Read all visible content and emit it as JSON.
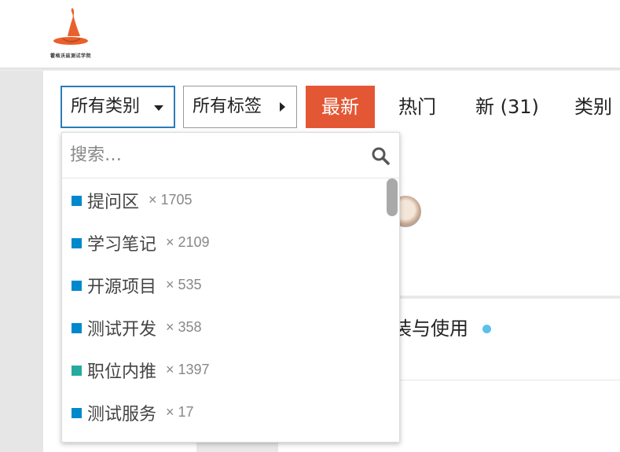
{
  "header": {
    "logo_text": "霍格沃兹测试学院",
    "logo_icon": "witch-hat-icon",
    "accent": "#e8612c"
  },
  "nav": {
    "categories_dropdown": "所有类别",
    "tags_dropdown": "所有标签",
    "tabs": [
      {
        "label": "最新",
        "active": true
      },
      {
        "label": "热门"
      },
      {
        "label": "新 (31)"
      },
      {
        "label": "类别"
      }
    ],
    "active_color": "#e45735"
  },
  "dropdown": {
    "search_placeholder": "搜索…",
    "items": [
      {
        "name": "提问区",
        "count": "× 1705",
        "color": "#0088cc"
      },
      {
        "name": "学习笔记",
        "count": "× 2109",
        "color": "#0088cc"
      },
      {
        "name": "开源项目",
        "count": "× 535",
        "color": "#0088cc"
      },
      {
        "name": "测试开发",
        "count": "× 358",
        "color": "#0088cc"
      },
      {
        "name": "职位内推",
        "count": "× 1397",
        "color": "#25aa9e"
      },
      {
        "name": "测试服务",
        "count": "× 17",
        "color": "#0088cc"
      }
    ]
  },
  "background": {
    "topic_title_fragment": "装与使用"
  }
}
